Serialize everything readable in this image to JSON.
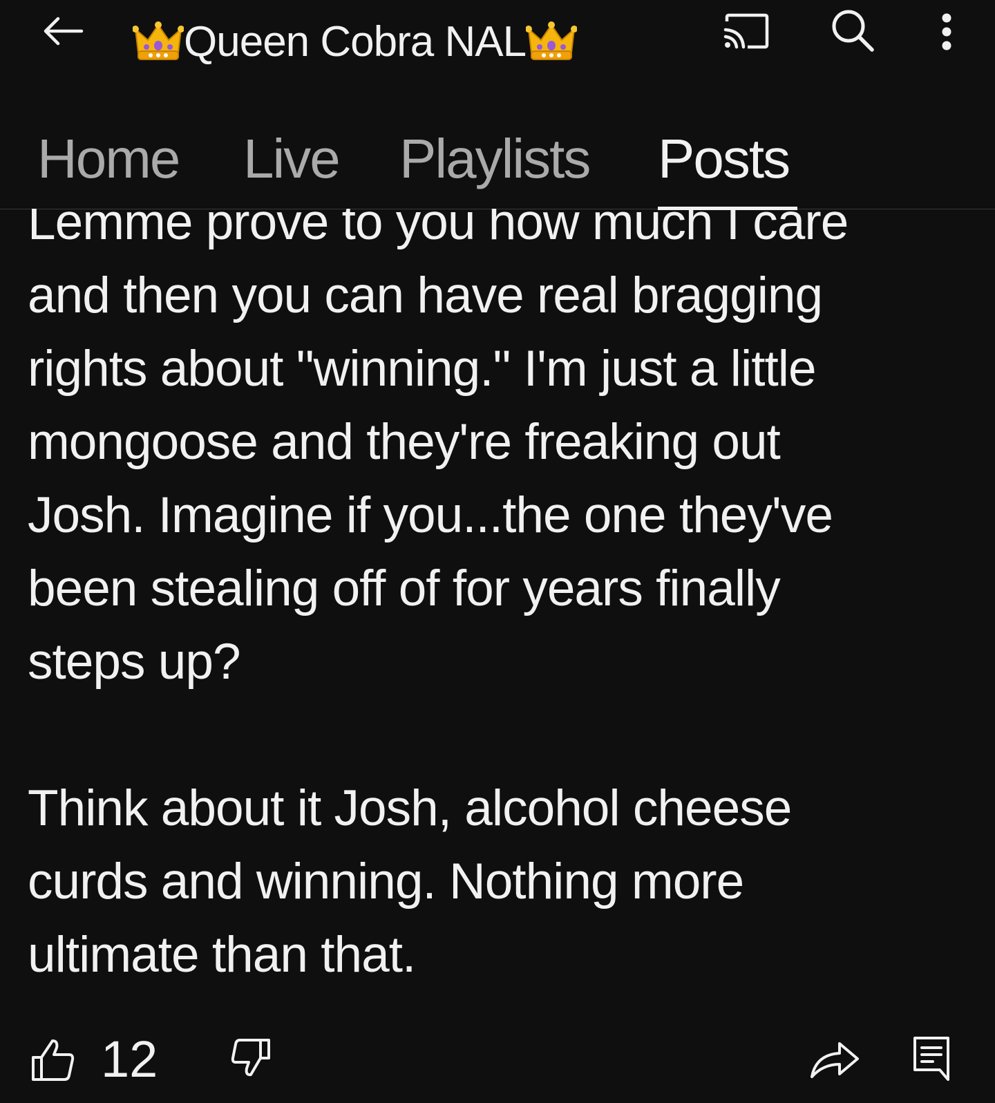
{
  "header": {
    "channel_name": "Queen Cobra NAL",
    "crown_emoji": "crown-emoji"
  },
  "tabs": [
    {
      "label": "Home",
      "active": false
    },
    {
      "label": "Live",
      "active": false
    },
    {
      "label": "Playlists",
      "active": false
    },
    {
      "label": "Posts",
      "active": true
    }
  ],
  "post": {
    "text": "Lemme prove to you how much I care\nand then you can have real bragging\nrights about \"winning.\" I'm just a little\nmongoose and they're freaking out\nJosh. Imagine if you...the one they've\nbeen stealing off of for years finally\nsteps up?\n\nThink about it Josh, alcohol cheese\ncurds and winning. Nothing more\nultimate than that."
  },
  "actions": {
    "like_count": "12"
  },
  "colors": {
    "background": "#0f0f0f",
    "text": "#f1f1f1",
    "inactive_tab": "#aaaaaa"
  }
}
